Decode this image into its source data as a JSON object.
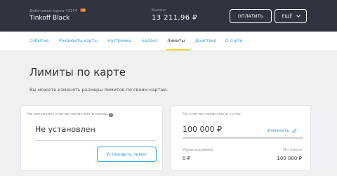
{
  "header": {
    "card_type": "Дебетовая карта *3174",
    "card_name": "Tinkoff Black",
    "balance_label": "Баланс",
    "balance_value": "13 211,96 ₽",
    "pay_button": "ОПЛАТИТЬ",
    "more_button": "ЕЩЁ"
  },
  "tabs": [
    {
      "label": "События"
    },
    {
      "label": "Реквизиты карты"
    },
    {
      "label": "Настройки"
    },
    {
      "label": "Баланс"
    },
    {
      "label": "Лимиты",
      "active": true
    },
    {
      "label": "Действия"
    },
    {
      "label": "О счете"
    }
  ],
  "page": {
    "title": "Лимиты по карте",
    "description": "Вы можете изменять размеры лимитов по своим картам."
  },
  "purchase_limit": {
    "label": "На покупки и снятие наличных в месяц",
    "help_icon": "?",
    "value": "Не установлен",
    "button": "Установить лимит"
  },
  "cash_limit": {
    "label": "На снятие наличных в сутки",
    "value": "100 000 ₽",
    "change_link": "Изменить",
    "spent_label": "Израсходовано",
    "spent_value": "0 ₽",
    "remaining_label": "Осталось",
    "remaining_value": "100 000 ₽",
    "used_fraction": 0
  },
  "colors": {
    "header_bg": "#2f3440",
    "accent_blue": "#3a9fd6",
    "active_underline": "#ffdd2d",
    "page_bg": "#eef0f3"
  },
  "icons": [
    "mastercard-icon",
    "chevron-down-icon",
    "help-icon",
    "pencil-icon"
  ]
}
